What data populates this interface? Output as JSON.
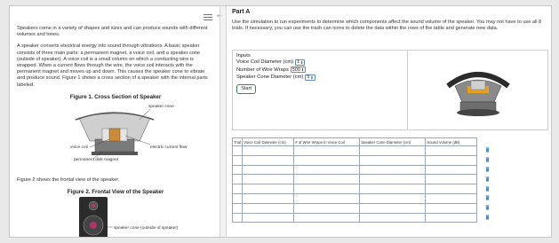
{
  "left": {
    "para1": "Speakers come in a variety of shapes and sizes and can produce sounds with different volumes and tones.",
    "para2": "A speaker converts electrical energy into sound through vibrations. A basic speaker consists of three main parts: a permanent magnet, a voice coil, and a speaker cone (outside of speaker). A voice coil is a small column on which a conducting wire is wrapped. When a current flows through the wire, the voice coil interacts with the permanent magnet and moves up and down. This causes the speaker cone to vibrate and produce sound. Figure 1 shows a cross section of a speaker with the internal parts labeled.",
    "figure1_title": "Figure 1. Cross Section of Speaker",
    "figure1_labels": {
      "cone": "speaker cone",
      "coil": "voice coil",
      "current": "electric current flow",
      "magnet": "permanent disk magnet"
    },
    "para3": "Figure 2 shows the frontal view of the speaker.",
    "figure2_title": "Figure 2. Frontal View of the Speaker",
    "figure2_label": "speaker cone (outside of speaker)"
  },
  "right": {
    "part_title": "Part A",
    "instructions": "Use the simulation to run experiments to determine which components affect the sound volume of the speaker. You may not have to use all 8 trials. If necessary, you can use the trash can icons to delete the data within the rows of the table and generate new data.",
    "inputs_title": "Inputs",
    "inputs": [
      {
        "label": "Voice Coil Diameter (cm)",
        "value": "1"
      },
      {
        "label": "Number of Wire Wraps",
        "value": "500"
      },
      {
        "label": "Speaker Cone Diameter (cm)",
        "value": "5"
      }
    ],
    "start_label": "Start",
    "table": {
      "headers": [
        "Trial",
        "Voice Coil Diameter (cm)",
        "# of Wire Wraps in Voice Coil",
        "Speaker Cone Diameter (cm)",
        "Sound Volume (dB)"
      ],
      "rows": [
        [
          "",
          "",
          "",
          "",
          ""
        ],
        [
          "",
          "",
          "",
          "",
          ""
        ],
        [
          "",
          "",
          "",
          "",
          ""
        ],
        [
          "",
          "",
          "",
          "",
          ""
        ],
        [
          "",
          "",
          "",
          "",
          ""
        ],
        [
          "",
          "",
          "",
          "",
          ""
        ],
        [
          "",
          "",
          "",
          "",
          ""
        ],
        [
          "",
          "",
          "",
          "",
          ""
        ]
      ]
    }
  },
  "colors": {
    "start_border": "#3a8a4a",
    "select_border": "#5b8bd0",
    "trash": "#3d8fd6",
    "table_border": "#9aa8b8"
  },
  "icons": [
    "menu-icon",
    "collapse-arrow-icon",
    "trash-icon"
  ]
}
